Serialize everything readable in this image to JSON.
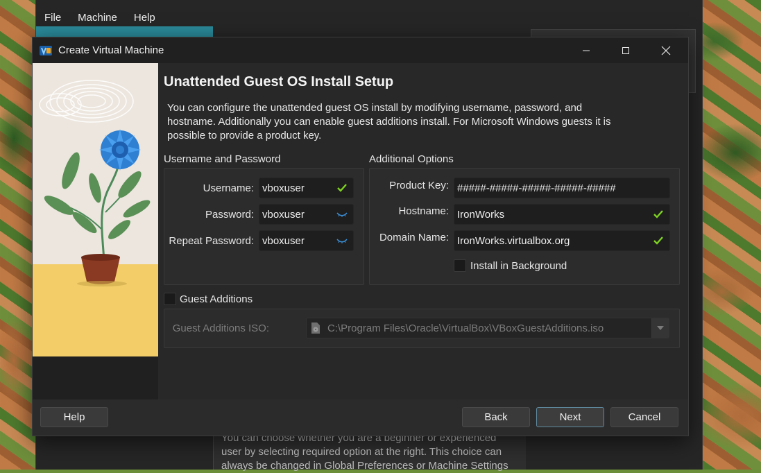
{
  "background_window": {
    "menu": [
      {
        "label": "File"
      },
      {
        "label": "Machine"
      },
      {
        "label": "Help"
      }
    ],
    "wizard_hint": "You can choose whether you are a beginner or experienced user by selecting required option at the right. This choice can always be changed in Global Preferences or Machine Settings"
  },
  "dialog": {
    "title": "Create Virtual Machine",
    "heading": "Unattended Guest OS Install Setup",
    "description": "You can configure the unattended guest OS install by modifying username, password, and hostname. Additionally you can enable guest additions install. For Microsoft Windows guests it is possible to provide a product key.",
    "user_group": {
      "title": "Username and Password",
      "username": {
        "label": "Username:",
        "value": "vboxuser",
        "status_icon": "check-icon"
      },
      "password": {
        "label": "Password:",
        "value": "vboxuser",
        "status_icon": "eye-closed-icon"
      },
      "repeat_password": {
        "label": "Repeat Password:",
        "value": "vboxuser",
        "status_icon": "eye-closed-icon"
      }
    },
    "options_group": {
      "title": "Additional Options",
      "product_key": {
        "label": "Product Key:",
        "value": "#####-#####-#####-#####-#####"
      },
      "hostname": {
        "label": "Hostname:",
        "value": "IronWorks",
        "status_icon": "check-icon"
      },
      "domain_name": {
        "label": "Domain Name:",
        "value": "IronWorks.virtualbox.org",
        "status_icon": "check-icon"
      },
      "install_background": {
        "label": "Install in Background",
        "checked": false
      }
    },
    "guest_additions": {
      "label": "Guest Additions",
      "checked": false,
      "iso_label": "Guest Additions ISO:",
      "iso_path": "C:\\Program Files\\Oracle\\VirtualBox\\VBoxGuestAdditions.iso"
    },
    "buttons": {
      "help": "Help",
      "back": "Back",
      "next": "Next",
      "cancel": "Cancel"
    }
  },
  "colors": {
    "accent_check": "#7ed321",
    "eye_icon": "#3a8fd6",
    "flower_blue": "#2f7fd3",
    "pot": "#8a3a22",
    "floor": "#f2cd68"
  }
}
